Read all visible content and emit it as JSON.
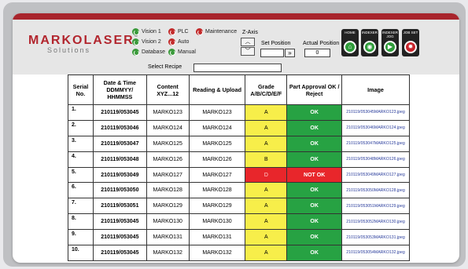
{
  "logo": {
    "main": "MARKOLASER",
    "registered": "®",
    "sub": "Solutions"
  },
  "status": [
    {
      "label": "Vision 1",
      "color": "#3a9a3a"
    },
    {
      "label": "Vision 2",
      "color": "#3a9a3a"
    },
    {
      "label": "Database",
      "color": "#3a9a3a"
    },
    {
      "label": "PLC",
      "color": "#c22a2a"
    },
    {
      "label": "Auto",
      "color": "#c22a2a"
    },
    {
      "label": "Manual",
      "color": "#3a9a3a"
    },
    {
      "label": "Maintenance",
      "color": "#c22a2a"
    }
  ],
  "zaxis": {
    "label": "Z-Axis",
    "up": "︿",
    "down": "﹀"
  },
  "set_position": {
    "label": "Set Position",
    "value": "",
    "go": "»"
  },
  "actual_position": {
    "label": "Actual Position",
    "value": "0"
  },
  "nav": {
    "home": "HOME",
    "indexer": "INDEXER",
    "indexer_jog": "INDEXER JOG",
    "job_set": "JOB SET"
  },
  "recipe": {
    "label": "Select Recipe",
    "value": ""
  },
  "table": {
    "headers": {
      "serial": "Serial No.",
      "datetime": "Date & Time DDMMYY/ HHMMSS",
      "content": "Content XYZ...12",
      "reading": "Reading & Upload",
      "grade": "Grade A/B/C/D/E/F",
      "approval": "Part Approval OK / Reject",
      "image": "Image"
    },
    "rows": [
      {
        "serial": "1.",
        "datetime": "210119/053045",
        "content": "MARKO123",
        "reading": "MARKO123",
        "grade": "A",
        "approval": "OK",
        "image": "210119/053045MARKO123.jpeg"
      },
      {
        "serial": "2.",
        "datetime": "210119/053046",
        "content": "MARKO124",
        "reading": "MARKO124",
        "grade": "A",
        "approval": "OK",
        "image": "210119/053046MARKO124.jpeg"
      },
      {
        "serial": "3.",
        "datetime": "210119/053047",
        "content": "MARKO125",
        "reading": "MARKO125",
        "grade": "A",
        "approval": "OK",
        "image": "210119/053047MARKO125.jpeg"
      },
      {
        "serial": "4.",
        "datetime": "210119/053048",
        "content": "MARKO126",
        "reading": "MARKO126",
        "grade": "B",
        "approval": "OK",
        "image": "210119/053048MARKO126.jpeg"
      },
      {
        "serial": "5.",
        "datetime": "210119/053049",
        "content": "MARKO127",
        "reading": "MARKO127",
        "grade": "D",
        "approval": "NOT OK",
        "image": "210119/053049MARKO127.jpeg"
      },
      {
        "serial": "6.",
        "datetime": "210119/053050",
        "content": "MARKO128",
        "reading": "MARKO128",
        "grade": "A",
        "approval": "OK",
        "image": "210119/053050MARKO128.jpeg"
      },
      {
        "serial": "7.",
        "datetime": "210119/053051",
        "content": "MARKO129",
        "reading": "MARKO129",
        "grade": "A",
        "approval": "OK",
        "image": "210119/053051MARKO129.jpeg"
      },
      {
        "serial": "8.",
        "datetime": "210119/053045",
        "content": "MARKO130",
        "reading": "MARKO130",
        "grade": "A",
        "approval": "OK",
        "image": "210119/053052MARKO130.jpeg"
      },
      {
        "serial": "9.",
        "datetime": "210119/053045",
        "content": "MARKO131",
        "reading": "MARKO131",
        "grade": "A",
        "approval": "OK",
        "image": "210119/053053MARKO131.jpeg"
      },
      {
        "serial": "10.",
        "datetime": "210119/053045",
        "content": "MARKO132",
        "reading": "MARKO132",
        "grade": "A",
        "approval": "OK",
        "image": "210119/053054MARKO132.jpeg"
      }
    ]
  }
}
